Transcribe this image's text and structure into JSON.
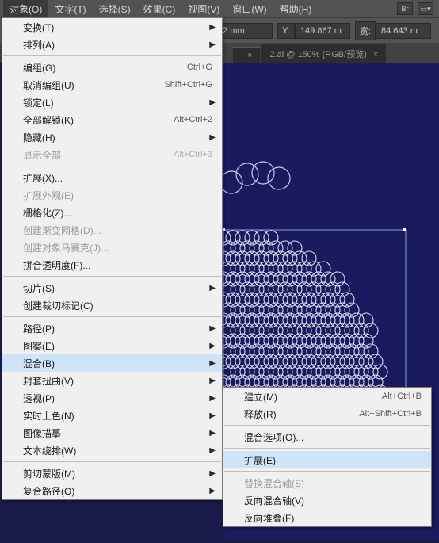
{
  "menubar": {
    "items": [
      "对象(O)",
      "文字(T)",
      "选择(S)",
      "效果(C)",
      "视图(V)",
      "窗口(W)",
      "帮助(H)"
    ],
    "br_label": "Br"
  },
  "toolbar": {
    "x_val": "2 mm",
    "y_lbl": "Y:",
    "y_val": "149.867 m",
    "w_lbl": "宽:",
    "w_val": "84.643 m"
  },
  "tabs": {
    "t1_close": "×",
    "t2_label": "2.ai @ 150% (RGB/预览)",
    "t2_close": "×"
  },
  "main_menu": [
    {
      "label": "变换(T)",
      "sub": true
    },
    {
      "label": "排列(A)",
      "sub": true
    },
    {
      "sep": true
    },
    {
      "label": "编组(G)",
      "sc": "Ctrl+G"
    },
    {
      "label": "取消编组(U)",
      "sc": "Shift+Ctrl+G"
    },
    {
      "label": "锁定(L)",
      "sub": true
    },
    {
      "label": "全部解锁(K)",
      "sc": "Alt+Ctrl+2"
    },
    {
      "label": "隐藏(H)",
      "sub": true
    },
    {
      "label": "显示全部",
      "sc": "Alt+Ctrl+3",
      "disabled": true
    },
    {
      "sep": true
    },
    {
      "label": "扩展(X)..."
    },
    {
      "label": "扩展外观(E)",
      "disabled": true
    },
    {
      "label": "栅格化(Z)..."
    },
    {
      "label": "创建渐变网格(D)...",
      "disabled": true
    },
    {
      "label": "创建对象马赛克(J)...",
      "disabled": true
    },
    {
      "label": "拼合透明度(F)..."
    },
    {
      "sep": true
    },
    {
      "label": "切片(S)",
      "sub": true
    },
    {
      "label": "创建裁切标记(C)"
    },
    {
      "sep": true
    },
    {
      "label": "路径(P)",
      "sub": true
    },
    {
      "label": "图案(E)",
      "sub": true
    },
    {
      "label": "混合(B)",
      "sub": true,
      "highlight": true
    },
    {
      "label": "封套扭曲(V)",
      "sub": true
    },
    {
      "label": "透视(P)",
      "sub": true
    },
    {
      "label": "实时上色(N)",
      "sub": true
    },
    {
      "label": "图像描摹",
      "sub": true
    },
    {
      "label": "文本绕排(W)",
      "sub": true
    },
    {
      "sep": true
    },
    {
      "label": "剪切蒙版(M)",
      "sub": true
    },
    {
      "label": "复合路径(O)",
      "sub": true
    }
  ],
  "sub_menu": [
    {
      "label": "建立(M)",
      "sc": "Alt+Ctrl+B"
    },
    {
      "label": "释放(R)",
      "sc": "Alt+Shift+Ctrl+B"
    },
    {
      "sep": true
    },
    {
      "label": "混合选项(O)..."
    },
    {
      "sep": true
    },
    {
      "label": "扩展(E)",
      "highlight": true
    },
    {
      "sep": true
    },
    {
      "label": "替换混合轴(S)",
      "disabled": true
    },
    {
      "label": "反向混合轴(V)"
    },
    {
      "label": "反向堆叠(F)"
    }
  ]
}
